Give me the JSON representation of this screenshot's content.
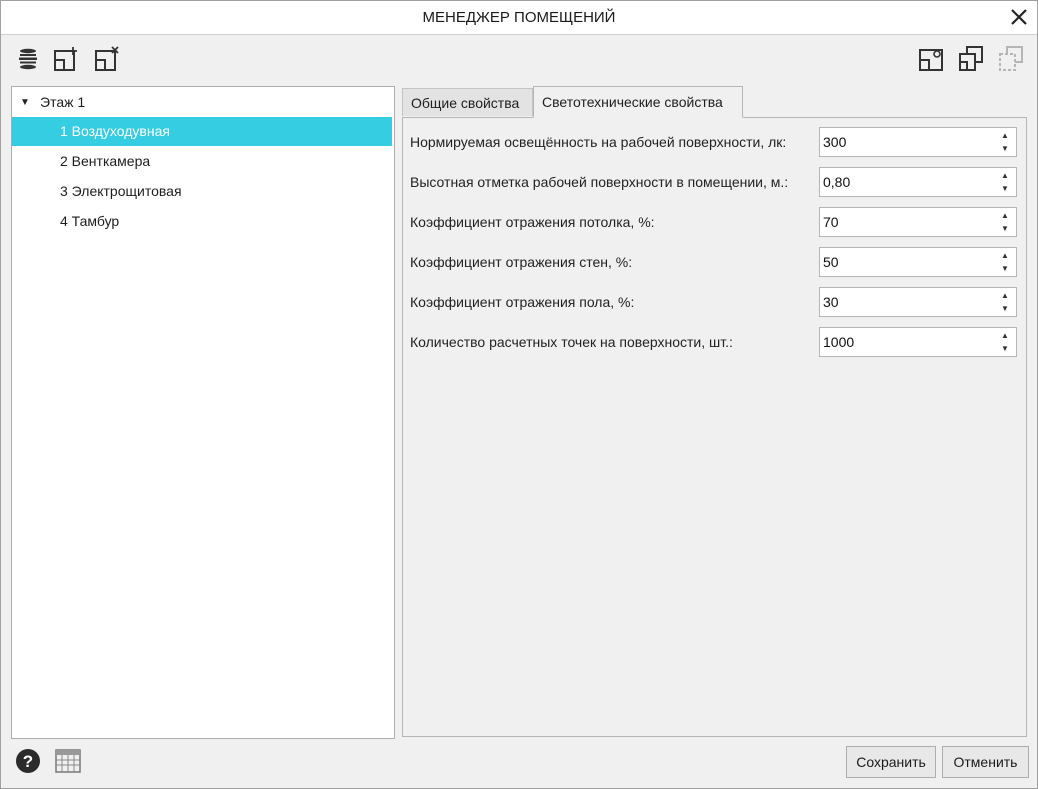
{
  "window": {
    "title": "МЕНЕДЖЕР ПОМЕЩЕНИЙ"
  },
  "toolbar": {
    "left_icons": [
      "layers-icon",
      "add-room-icon",
      "delete-room-icon"
    ],
    "right_icons": [
      "room-settings-icon",
      "copy-room-icon",
      "paste-room-icon"
    ]
  },
  "tree": {
    "floor_label": "Этаж 1",
    "rooms": [
      {
        "label": "1 Воздуходувная",
        "selected": true
      },
      {
        "label": "2 Венткамера",
        "selected": false
      },
      {
        "label": "3 Электрощитовая",
        "selected": false
      },
      {
        "label": "4 Тамбур",
        "selected": false
      }
    ]
  },
  "tabs": [
    {
      "label": "Общие свойства",
      "active": false
    },
    {
      "label": "Светотехнические свойства",
      "active": true
    }
  ],
  "properties": [
    {
      "label": "Нормируемая освещённость на рабочей поверхности, лк:",
      "value": "300"
    },
    {
      "label": "Высотная отметка рабочей поверхности в помещении, м.:",
      "value": "0,80"
    },
    {
      "label": "Коэффициент отражения потолка, %:",
      "value": "70"
    },
    {
      "label": "Коэффициент отражения стен, %:",
      "value": "50"
    },
    {
      "label": "Коэффициент отражения пола, %:",
      "value": "30"
    },
    {
      "label": "Количество расчетных точек на поверхности, шт.:",
      "value": "1000"
    }
  ],
  "footer": {
    "help_icon": "help-icon",
    "table_icon": "table-icon",
    "save_label": "Сохранить",
    "cancel_label": "Отменить"
  },
  "colors": {
    "selection": "#35cde2"
  }
}
